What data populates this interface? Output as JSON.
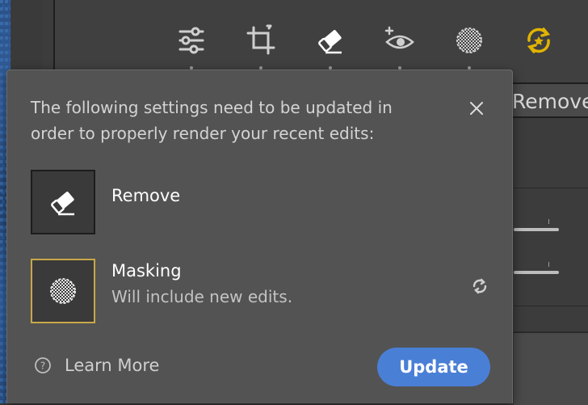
{
  "toolbar": {
    "tools": [
      {
        "icon": "sliders-icon"
      },
      {
        "icon": "crop-icon"
      },
      {
        "icon": "eraser-icon"
      },
      {
        "icon": "red-eye-icon"
      },
      {
        "icon": "mask-icon"
      },
      {
        "icon": "presets-icon"
      }
    ]
  },
  "side_panel": {
    "remove_tab_label": "Remove"
  },
  "dialog": {
    "message": "The following settings need to be updated in order to properly render your recent edits:",
    "items": [
      {
        "title": "Remove",
        "subtitle": "",
        "icon": "eraser-icon"
      },
      {
        "title": "Masking",
        "subtitle": "Will include new edits.",
        "icon": "mask-icon",
        "badge_icon": "sync-icon"
      }
    ],
    "learn_more_label": "Learn More",
    "update_label": "Update"
  },
  "colors": {
    "accent": "#4a7fd6",
    "selected_border": "#c8a94a",
    "preset_icon": "#e2b400"
  }
}
